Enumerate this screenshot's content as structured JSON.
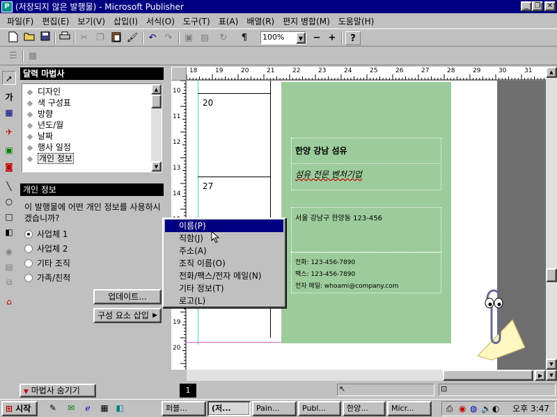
{
  "window": {
    "title": "(저장되지 않은 발행물) - Microsoft Publisher",
    "app_icon_label": "P",
    "min_label": "_",
    "restore_label": "❐",
    "close_label": "✕"
  },
  "menu": [
    {
      "label": "파일(F)"
    },
    {
      "label": "편집(E)"
    },
    {
      "label": "보기(V)"
    },
    {
      "label": "삽입(I)"
    },
    {
      "label": "서식(O)"
    },
    {
      "label": "도구(T)"
    },
    {
      "label": "표(A)"
    },
    {
      "label": "배열(R)"
    },
    {
      "label": "편지 병합(M)"
    },
    {
      "label": "도움말(H)"
    }
  ],
  "toolbar": {
    "zoom_value": "100%",
    "zoom_out": "−",
    "zoom_in": "+",
    "pilcrow": "¶",
    "help": "?",
    "icons": [
      "new-icon",
      "open-icon",
      "save-icon",
      "print-icon",
      "cut-icon",
      "copy-icon",
      "paste-icon",
      "format-painter-icon",
      "undo-icon",
      "redo-icon",
      "bring-front-icon",
      "send-back-icon",
      "rotate-icon"
    ]
  },
  "wizard": {
    "title": "달력 마법사",
    "items": [
      {
        "label": "디자인"
      },
      {
        "label": "색 구성표"
      },
      {
        "label": "방향"
      },
      {
        "label": "년도/월"
      },
      {
        "label": "날짜"
      },
      {
        "label": "행사 일정"
      },
      {
        "label": "개인 정보"
      }
    ],
    "section_title": "개인 정보",
    "question": "이 발행물에 어떤 개인 정보를 사용하시겠습니까?",
    "radios": [
      {
        "label": "사업체 1",
        "checked": true
      },
      {
        "label": "사업체 2",
        "checked": false
      },
      {
        "label": "기타 조직",
        "checked": false
      },
      {
        "label": "가족/친척",
        "checked": false
      }
    ],
    "update_button": "업데이트...",
    "insert_button": "구성 요소 삽입"
  },
  "ruler": {
    "h_numbers": [
      "18",
      "19",
      "20",
      "21",
      "22",
      "23",
      "24",
      "25",
      "26",
      "27",
      "28",
      "29",
      "30",
      "31"
    ],
    "v_numbers": [
      "10",
      "11",
      "12",
      "13",
      "14",
      "15",
      "16",
      "17",
      "18",
      "19",
      "20"
    ]
  },
  "document": {
    "cal_numbers": [
      "20",
      "27"
    ],
    "org_name": "한양 강남 섬유",
    "tagline": "섬유 전문 벤처기업",
    "address": "서울 강남구 한양동 123-456",
    "phone": "전화: 123-456-7890",
    "fax": "팩스: 123-456-7890",
    "email": "전자 메일: whoami@company.com"
  },
  "popup_menu": [
    {
      "label": "이름(P)",
      "highlighted": true
    },
    {
      "label": "직함(J)",
      "highlighted": false
    },
    {
      "label": "주소(A)",
      "highlighted": false
    },
    {
      "label": "조직 이름(O)",
      "highlighted": false
    },
    {
      "label": "전화/팩스/전자 메일(N)",
      "highlighted": false
    },
    {
      "label": "기타 정보(T)",
      "highlighted": false
    },
    {
      "label": "로고(L)",
      "highlighted": false
    }
  ],
  "statusbar": {
    "hide_wizard": "마법사 숨기기",
    "page_number": "1"
  },
  "taskbar": {
    "start": "시작",
    "tasks": [
      {
        "label": "퍼블...",
        "active": false
      },
      {
        "label": "(저...",
        "active": true
      },
      {
        "label": "Pain...",
        "active": false
      },
      {
        "label": "Publ...",
        "active": false
      },
      {
        "label": "한양...",
        "active": false
      },
      {
        "label": "Micr...",
        "active": false
      }
    ],
    "clock": "오후 3:47"
  }
}
